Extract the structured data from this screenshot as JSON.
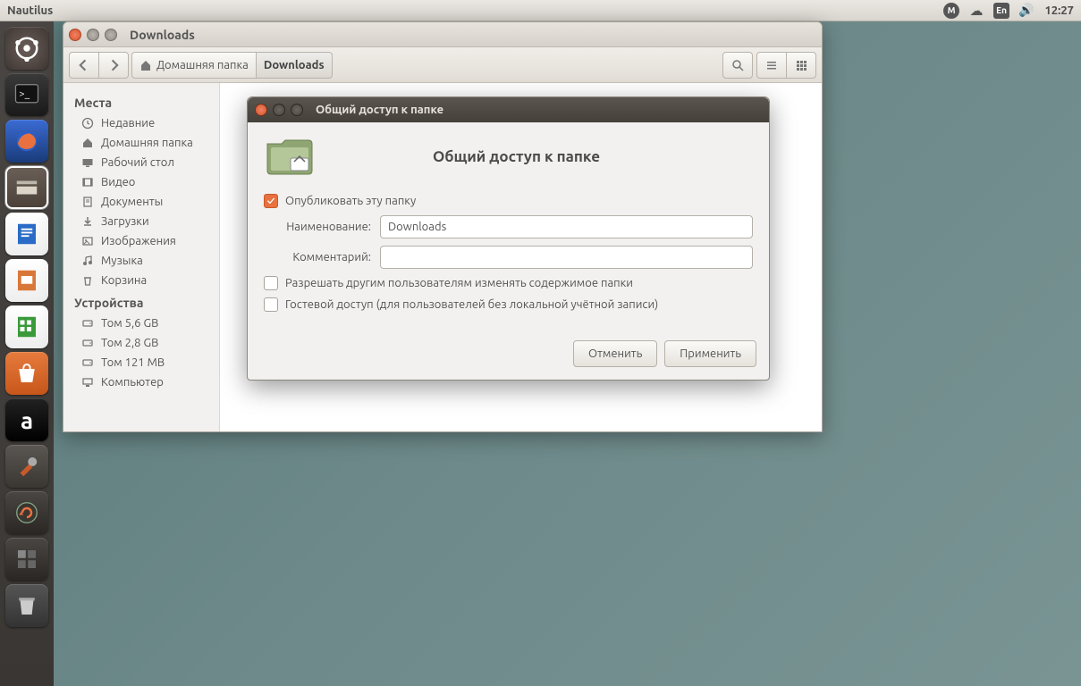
{
  "panel": {
    "app_title": "Nautilus",
    "indicators": {
      "m": "M",
      "cloud": "cloud",
      "lang": "En",
      "sound": "vol"
    },
    "clock": "12:27"
  },
  "nautilus": {
    "window_title": "Downloads",
    "path": {
      "home_label": "Домашняя папка",
      "current": "Downloads"
    }
  },
  "sidebar": {
    "places_header": "Места",
    "places": [
      {
        "icon": "clock",
        "label": "Недавние"
      },
      {
        "icon": "home",
        "label": "Домашняя папка"
      },
      {
        "icon": "desktop",
        "label": "Рабочий стол"
      },
      {
        "icon": "video",
        "label": "Видео"
      },
      {
        "icon": "doc",
        "label": "Документы"
      },
      {
        "icon": "download",
        "label": "Загрузки"
      },
      {
        "icon": "image",
        "label": "Изображения"
      },
      {
        "icon": "music",
        "label": "Музыка"
      },
      {
        "icon": "trash",
        "label": "Корзина"
      }
    ],
    "devices_header": "Устройства",
    "devices": [
      {
        "icon": "drive",
        "label": "Том 5,6 GB"
      },
      {
        "icon": "drive",
        "label": "Том 2,8 GB"
      },
      {
        "icon": "drive",
        "label": "Том 121 MB"
      },
      {
        "icon": "computer",
        "label": "Компьютер"
      }
    ]
  },
  "dialog": {
    "window_title": "Общий доступ к папке",
    "heading": "Общий доступ к папке",
    "share_checkbox_label": "Опубликовать эту папку",
    "share_checked": true,
    "name_label": "Наименование:",
    "name_value": "Downloads",
    "comment_label": "Комментарий:",
    "comment_value": "",
    "allow_write_label": "Разрешать другим пользователям изменять содержимое папки",
    "allow_write_checked": false,
    "guest_label": "Гостевой доступ (для пользователей без локальной учётной записи)",
    "guest_checked": false,
    "cancel_label": "Отменить",
    "apply_label": "Применить"
  }
}
